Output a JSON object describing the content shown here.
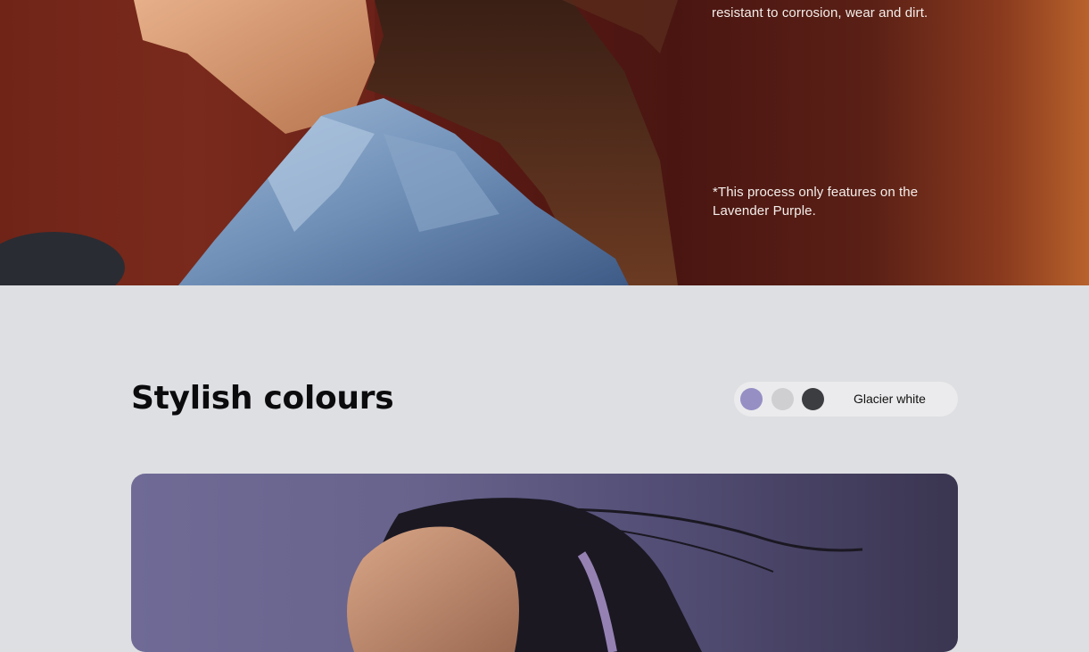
{
  "hero": {
    "text_top": "resistant to corrosion, wear and dirt.",
    "footnote": "*This process only features on the Lavender Purple."
  },
  "colours_section": {
    "title": "Stylish colours",
    "selected_label": "Glacier white",
    "swatches": [
      {
        "name": "Lavender Purple",
        "color": "#958fc4"
      },
      {
        "name": "Glacier white",
        "color": "#cfcfd1"
      },
      {
        "name": "Dark",
        "color": "#3c3d40"
      }
    ]
  },
  "colors": {
    "page_bg": "#dedfe2",
    "hero_bg": "#5c1a14",
    "card_bg": "#6a6590"
  }
}
